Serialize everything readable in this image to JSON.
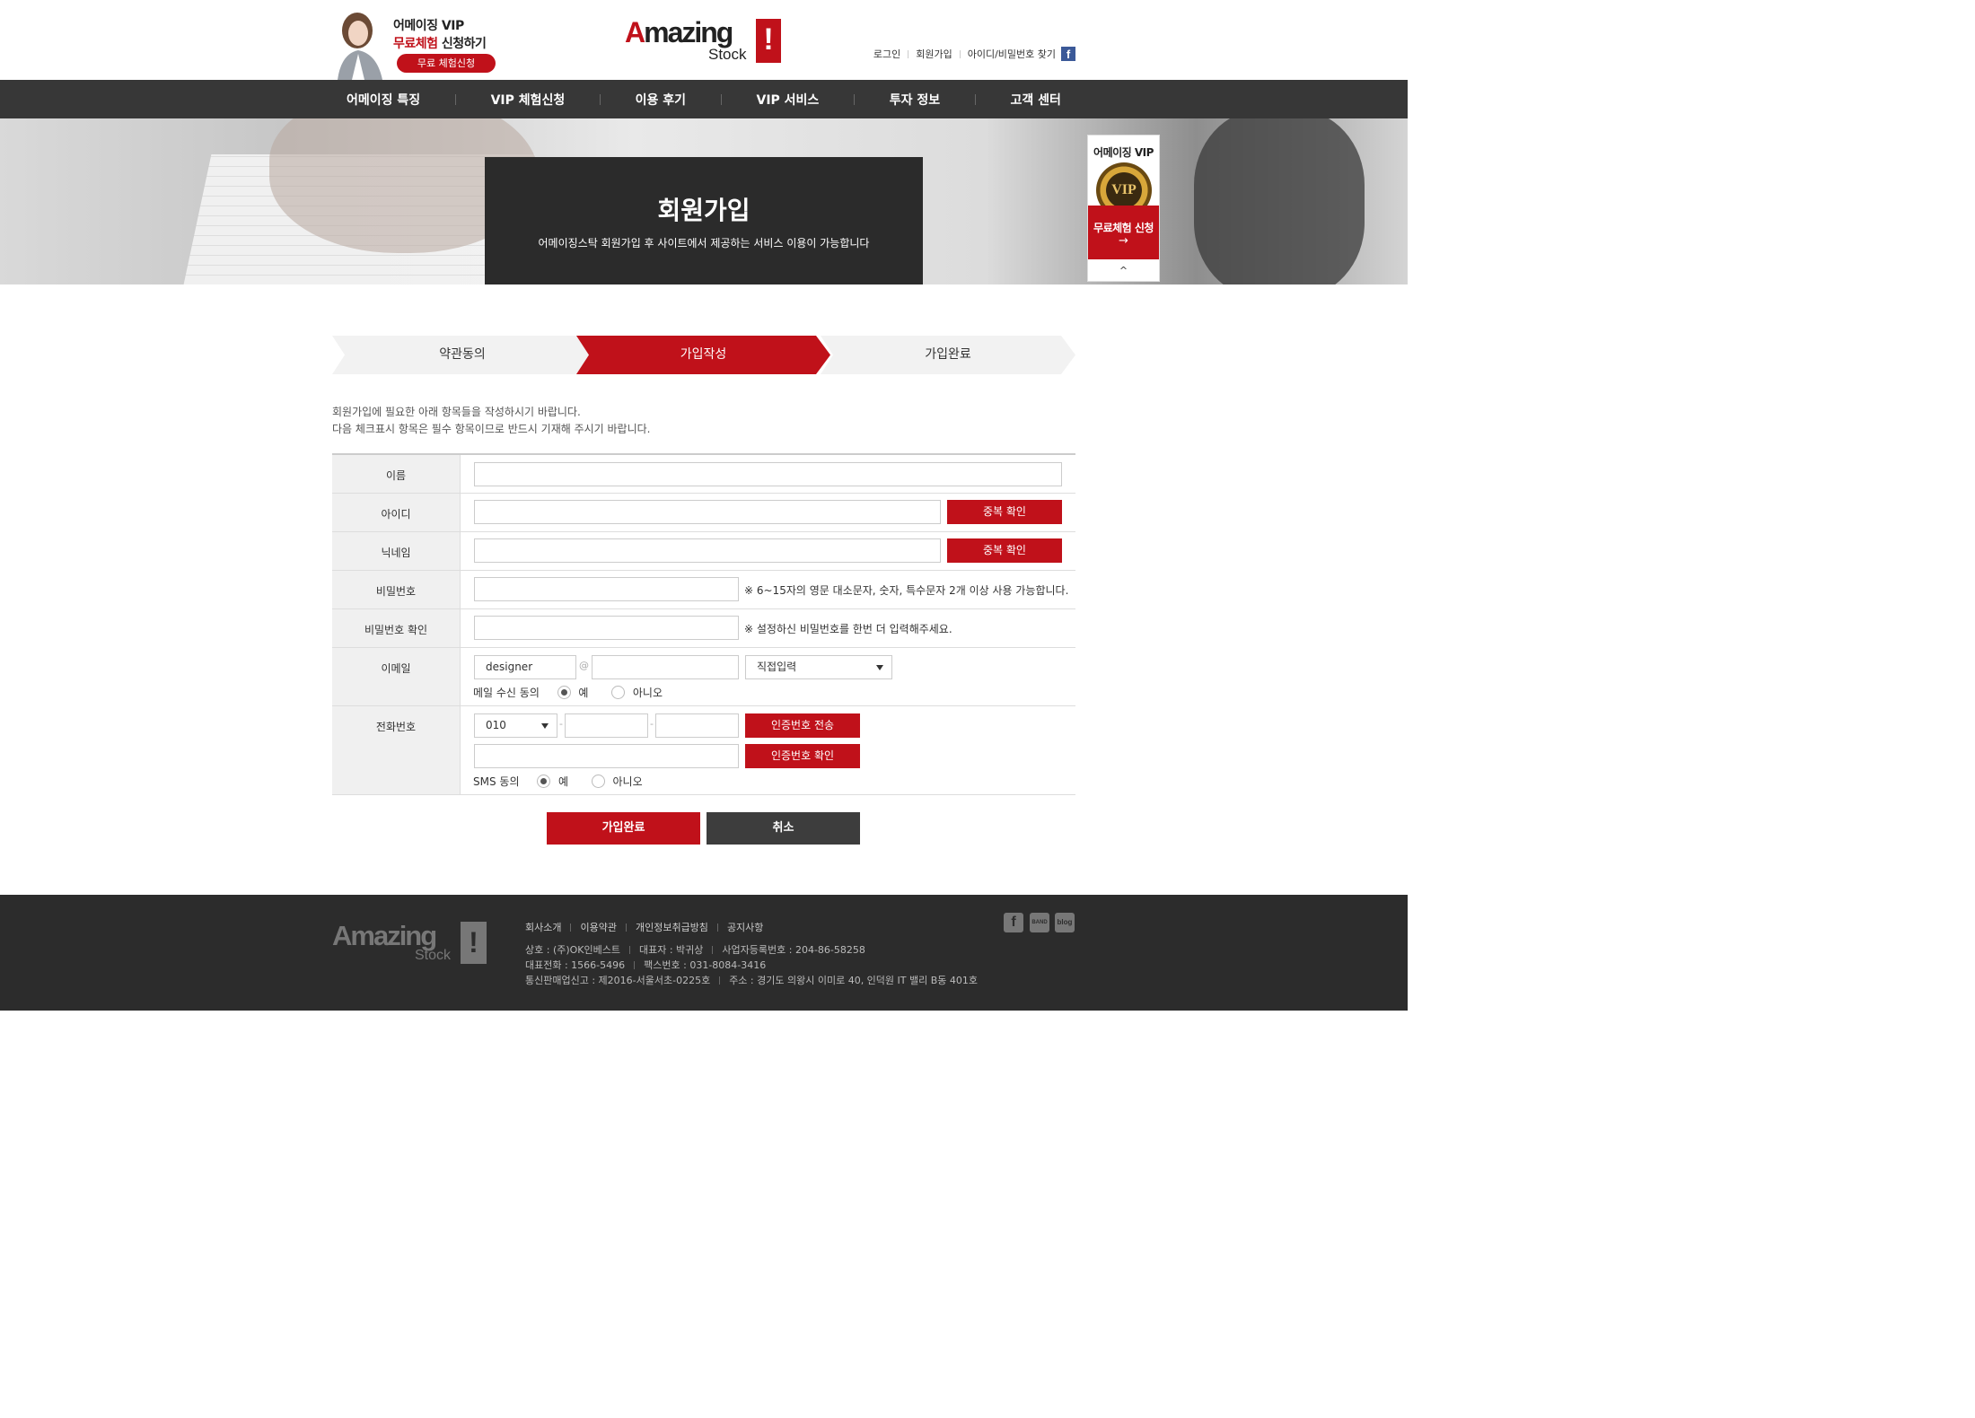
{
  "header": {
    "promo": {
      "line1": "어메이징 VIP",
      "line2_red": "무료체험",
      "line2_rest": " 신청하기",
      "button": "무료 체험신청"
    },
    "logo": {
      "amazing_a": "A",
      "amazing_rest": "mazing",
      "stock": "Stock",
      "exclaim": "!"
    },
    "util_links": {
      "login": "로그인",
      "join": "회원가입",
      "find": "아이디/비밀번호 찾기",
      "facebook_icon": "f"
    }
  },
  "nav": {
    "items": [
      "어메이징 특징",
      "VIP 체험신청",
      "이용 후기",
      "VIP 서비스",
      "투자 정보",
      "고객 센터"
    ]
  },
  "hero": {
    "title": "회원가입",
    "subtitle": "어메이징스탁 회원가입 후 사이트에서 제공하는 서비스 이용이 가능합니다"
  },
  "side_banner": {
    "title": "어메이징 VIP",
    "medal_text": "VIP",
    "cta": "무료체험 신청",
    "cta_arrow": "→",
    "top_icon": "^"
  },
  "steps": {
    "items": [
      "약관동의",
      "가입작성",
      "가입완료"
    ],
    "active_index": 1,
    "active_color": "#c0111a"
  },
  "intro": {
    "line1": "회원가입에 필요한 아래 항목들을 작성하시기 바랍니다.",
    "line2": "다음 체크표시 항목은 필수 항목이므로 반드시 기재해 주시기 바랍니다."
  },
  "form": {
    "name_label": "이름",
    "name_value": "",
    "id_label": "아이디",
    "id_value": "",
    "id_check": "중복 확인",
    "nick_label": "닉네임",
    "nick_value": "",
    "nick_check": "중복 확인",
    "pw_label": "비밀번호",
    "pw_note": "※ 6~15자의 영문 대소문자, 숫자, 특수문자 2개 이상 사용 가능합니다.",
    "pw2_label": "비밀번호 확인",
    "pw2_note": "※ 설정하신 비밀번호를 한번 더 입력해주세요.",
    "email_label": "이메일",
    "email_user": "designer",
    "email_at": "@",
    "email_domain": "",
    "email_select": "직접입력",
    "mail_consent_label": "메일 수신 동의",
    "mail_consent_yes": "예",
    "mail_consent_no": "아니오",
    "mail_consent_selected": "예",
    "phone_label": "전화번호",
    "phone_prefix": "010",
    "phone_dash": "-",
    "phone_mid": "",
    "phone_last": "",
    "send_code": "인증번호 전송",
    "code_value": "",
    "verify_code": "인증번호 확인",
    "sms_consent_label": "SMS 동의",
    "sms_consent_yes": "예",
    "sms_consent_no": "아니오",
    "sms_consent_selected": "예"
  },
  "actions": {
    "submit": "가입완료",
    "cancel": "취소"
  },
  "footer": {
    "logo": {
      "amazing_a": "A",
      "amazing_rest": "mazing",
      "stock": "Stock",
      "exclaim": "!"
    },
    "links": [
      "회사소개",
      "이용약관",
      "개인정보취급방침",
      "공지사항"
    ],
    "company": "상호 : (주)OK인베스트",
    "ceo": "대표자 : 박귀상",
    "biz_no": "사업자등록번호 : 204-86-58258",
    "tel": "대표전화 : 1566-5496",
    "fax": "팩스번호 : 031-8084-3416",
    "ecommerce": "통신판매업신고 : 제2016-서울서초-0225호",
    "address": "주소 : 경기도 의왕시 이미로 40, 인덕원 IT 밸리 B동 401호",
    "social_icons": {
      "facebook": "f",
      "band": "BAND",
      "blog": "blog"
    }
  }
}
